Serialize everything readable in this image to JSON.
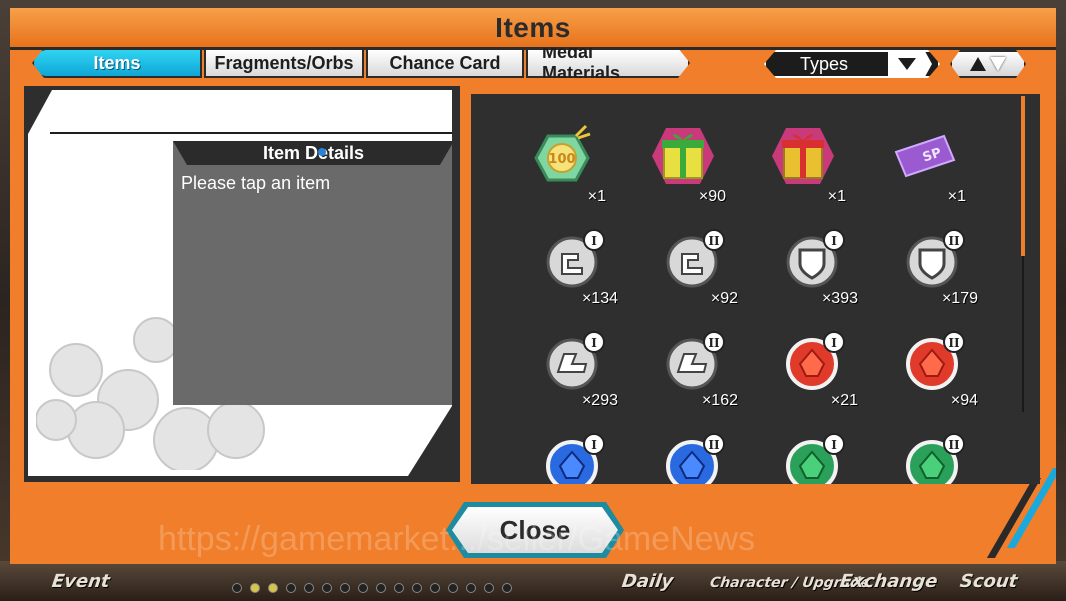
{
  "window": {
    "title": "Items"
  },
  "tabs": [
    {
      "label": "Items",
      "active": true
    },
    {
      "label": "Fragments/Orbs",
      "active": false
    },
    {
      "label": "Chance Card",
      "active": false
    },
    {
      "label": "Medal Materials",
      "active": false
    }
  ],
  "filter": {
    "types_label": "Types",
    "dropdown_icon": "chevron-down-icon",
    "sort_icon": "sort-up-down-icon"
  },
  "detail": {
    "header": "Item Details",
    "message": "Please tap an item"
  },
  "items": [
    {
      "name": "ticket-100",
      "count": "×1"
    },
    {
      "name": "gift-green",
      "count": "×90"
    },
    {
      "name": "gift-red",
      "count": "×1"
    },
    {
      "name": "sp-ticket",
      "count": "×1"
    },
    {
      "name": "fist-medal-1",
      "count": "×134"
    },
    {
      "name": "fist-medal-2",
      "count": "×92"
    },
    {
      "name": "shield-medal-1",
      "count": "×393"
    },
    {
      "name": "shield-medal-2",
      "count": "×179"
    },
    {
      "name": "shoe-medal-1",
      "count": "×293"
    },
    {
      "name": "shoe-medal-2",
      "count": "×162"
    },
    {
      "name": "red-orb-1",
      "count": "×21"
    },
    {
      "name": "red-orb-2",
      "count": "×94"
    },
    {
      "name": "blue-orb-1",
      "count": ""
    },
    {
      "name": "blue-orb-2",
      "count": ""
    },
    {
      "name": "green-orb-1",
      "count": ""
    },
    {
      "name": "green-orb-2",
      "count": ""
    }
  ],
  "close_label": "Close",
  "watermark": "https://gamemarket.../seller/GameNews",
  "bottom_nav": {
    "event": "Event",
    "daily": "Daily",
    "character": "Character / Upgrade",
    "exchange": "Exchange",
    "scout": "Scout"
  },
  "colors": {
    "accent": "#f07e2a",
    "tab_active": "#1aa9dd",
    "panel": "#2f2f2f"
  }
}
